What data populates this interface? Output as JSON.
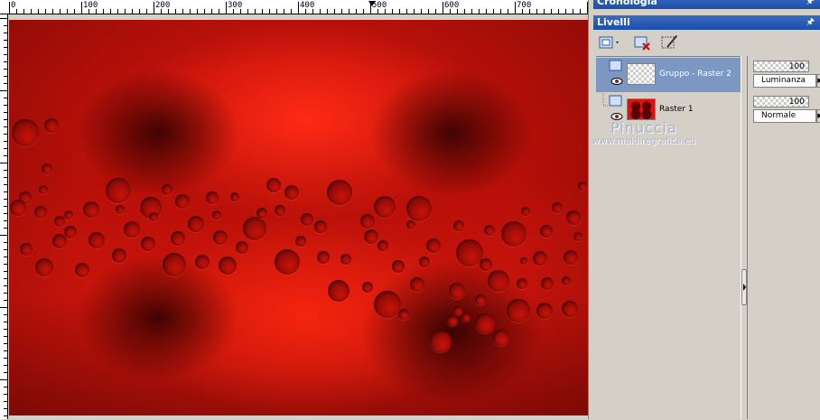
{
  "ruler": {
    "labels": [
      "0",
      "100",
      "200",
      "300",
      "400",
      "500",
      "600",
      "700"
    ]
  },
  "panels": {
    "history_title": "Cronologia",
    "layers_title": "Livelli"
  },
  "toolbar": {
    "icons": [
      "new-layer-icon",
      "delete-layer-icon",
      "layer-properties-icon"
    ]
  },
  "layers": [
    {
      "name": "Gruppo - Raster 2",
      "opacity": "100",
      "blend_mode": "Luminanza",
      "selected": true,
      "thumbnail": "transparent"
    },
    {
      "name": "Raster 1",
      "opacity": "100",
      "blend_mode": "Normale",
      "selected": false,
      "thumbnail": "red-bubbles"
    }
  ],
  "watermark": {
    "line1": "Pinuccia",
    "line2": "www.maidiregrafica.eu"
  },
  "colors": {
    "canvas_red": "#d0150c",
    "title_blue": "#1c4fa8",
    "selection_blue": "#7b97c2"
  }
}
